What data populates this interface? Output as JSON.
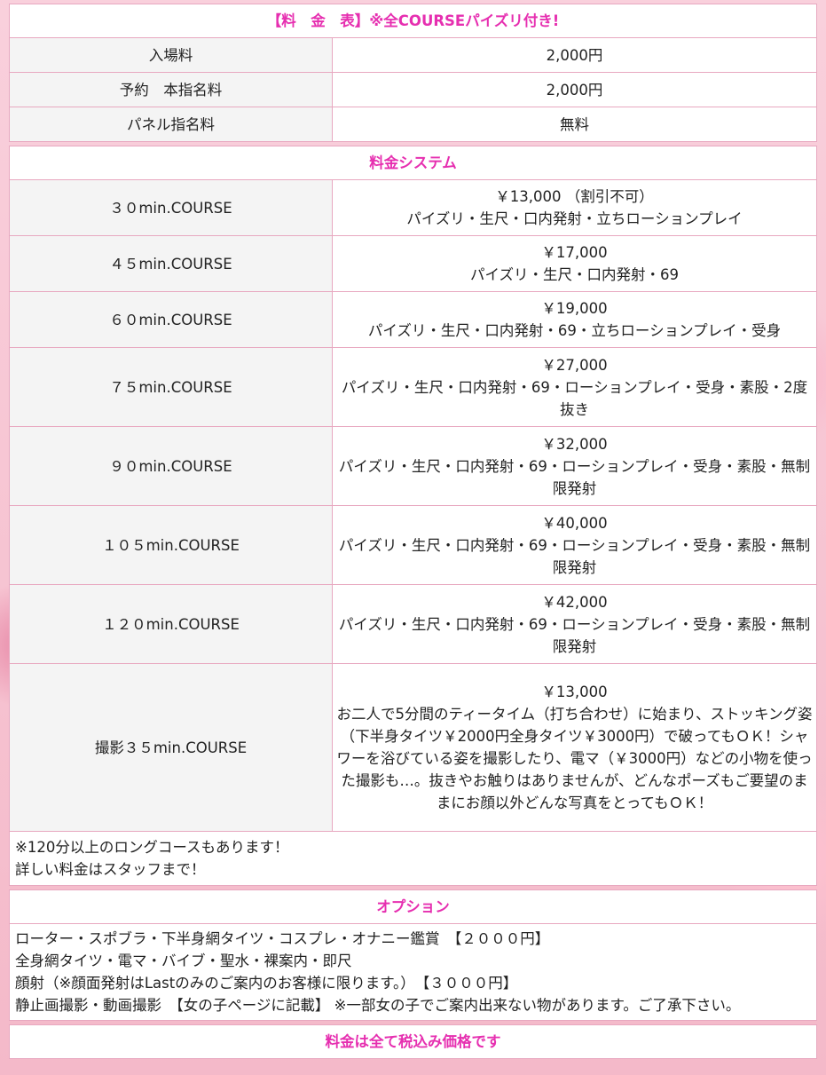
{
  "header1": "【料　金　表】※全COURSEパイズリ付き!",
  "basic_fees": [
    {
      "label": "入場料",
      "value": "2,000円"
    },
    {
      "label": "予約　本指名料",
      "value": "2,000円"
    },
    {
      "label": "パネル指名料",
      "value": "無料"
    }
  ],
  "header2": "料金システム",
  "courses": [
    {
      "name": "３０min.COURSE",
      "price": "￥13,000 （割引不可）",
      "desc": "パイズリ・生尺・口内発射・立ちローションプレイ"
    },
    {
      "name": "４５min.COURSE",
      "price": "￥17,000",
      "desc": "パイズリ・生尺・口内発射・69"
    },
    {
      "name": "６０min.COURSE",
      "price": "￥19,000",
      "desc": "パイズリ・生尺・口内発射・69・立ちローションプレイ・受身"
    },
    {
      "name": "７５min.COURSE",
      "price": "￥27,000",
      "desc": "パイズリ・生尺・口内発射・69・ローションプレイ・受身・素股・2度抜き"
    },
    {
      "name": "９０min.COURSE",
      "price": "￥32,000",
      "desc": "パイズリ・生尺・口内発射・69・ローションプレイ・受身・素股・無制限発射"
    },
    {
      "name": "１０５min.COURSE",
      "price": "￥40,000",
      "desc": "パイズリ・生尺・口内発射・69・ローションプレイ・受身・素股・無制限発射"
    },
    {
      "name": "１２０min.COURSE",
      "price": "￥42,000",
      "desc": "パイズリ・生尺・口内発射・69・ローションプレイ・受身・素股・無制限発射"
    },
    {
      "name": "撮影３５min.COURSE",
      "price": "￥13,000",
      "desc": "お二人で5分間のティータイム（打ち合わせ）に始まり、ストッキング姿（下半身タイツ￥2000円全身タイツ￥3000円）で破ってもＯＫ！シャワーを浴びている姿を撮影したり、電マ（￥3000円）などの小物を使った撮影も…。抜きやお触りはありませんが、どんなポーズもご要望のままにお顔以外どんな写真をとってもＯＫ！"
    }
  ],
  "long_course_note": [
    "※120分以上のロングコースもあります！",
    "詳しい料金はスタッフまで！"
  ],
  "header3": "オプション",
  "options": [
    "ローター・スポブラ・下半身網タイツ・コスプレ・オナニー鑑賞　【２０００円】",
    "全身網タイツ・電マ・バイブ・聖水・裸案内・即尺",
    "顔射（※顔面発射はLastのみのご案内のお客様に限ります。）　【３０００円】",
    "静止画撮影・動画撮影　【女の子ページに記載】 ※一部女の子でご案内出来ない物があります。ご了承下さい。"
  ],
  "footer": "料金は全て税込み価格です"
}
